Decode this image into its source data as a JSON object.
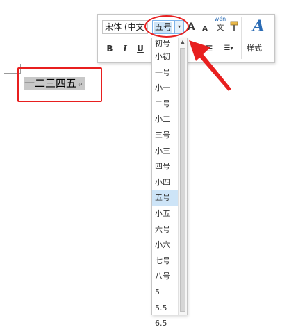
{
  "document": {
    "selected_text": "一二三四五",
    "paragraph_mark": "↵"
  },
  "toolbar": {
    "font_name": "宋体 (中文",
    "font_size": "五号",
    "dropdown_arrow": "▾",
    "grow_font": "A",
    "shrink_font": "A",
    "phonetic_top": "wén",
    "phonetic_bottom": "文",
    "format_painter_icon": "paintbrush-icon",
    "bold": "B",
    "italic": "I",
    "underline": "U",
    "bullets": "☰",
    "numbering": "☰",
    "styles_icon": "A",
    "styles_label": "样式"
  },
  "font_size_list": {
    "items": [
      "初号",
      "小初",
      "一号",
      "小一",
      "二号",
      "小二",
      "三号",
      "小三",
      "四号",
      "小四",
      "五号",
      "小五",
      "六号",
      "小六",
      "七号",
      "八号",
      "5",
      "5.5",
      "6.5"
    ],
    "selected": "五号"
  },
  "scrollbar": {
    "up_arrow": "▲"
  },
  "colors": {
    "annotation_red": "#e81f1f",
    "selection_blue": "#cde4f7",
    "text_highlight_gray": "#c8c8c8",
    "styles_blue": "#2b6cb5"
  }
}
